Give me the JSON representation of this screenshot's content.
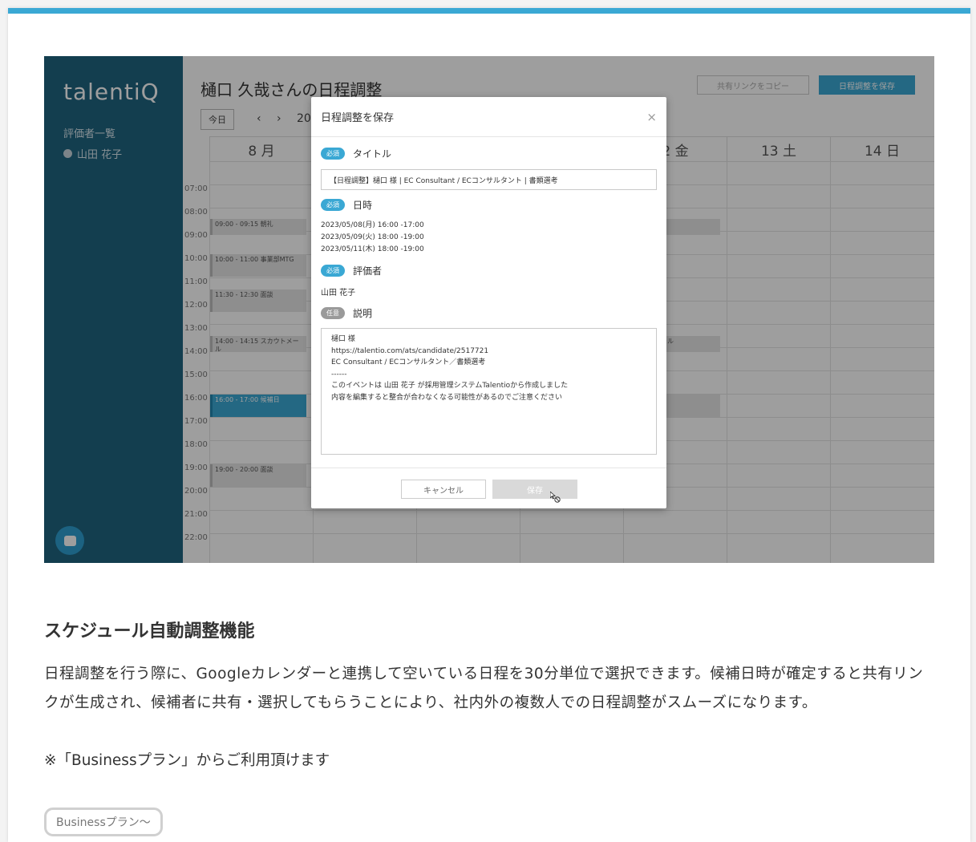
{
  "screenshot": {
    "logo": "talentiQ",
    "sidebar": {
      "evaluators_link": "評価者一覧",
      "user": "山田 花子"
    },
    "calendar": {
      "title": "樋口 久哉さんの日程調整",
      "share_link_button": "共有リンクをコピー",
      "save_button": "日程調整を保存",
      "today_button": "今日",
      "prev": "‹",
      "next": "›",
      "year_partial": "20",
      "day_headers": [
        "8 月",
        "",
        "",
        "2 金",
        "13 土",
        "14 日"
      ],
      "hours": [
        "07:00",
        "08:00",
        "09:00",
        "10:00",
        "11:00",
        "12:00",
        "13:00",
        "14:00",
        "15:00",
        "16:00",
        "17:00",
        "18:00",
        "19:00",
        "20:00",
        "21:00",
        "22:00"
      ],
      "events": [
        {
          "text": "09:00 - 09:15  朝礼"
        },
        {
          "text": "10:00 - 11:00 事業部MTG"
        },
        {
          "text": "11:30 - 12:30 面談"
        },
        {
          "text": "14:00 - 14:15  スカウトメール"
        },
        {
          "text": "16:00 - 17:00 候補日"
        },
        {
          "text": "19:00 - 20:00 面談"
        },
        {
          "text": "朝礼"
        },
        {
          "text": "スカウトメール"
        },
        {
          "text": ""
        }
      ]
    },
    "modal": {
      "title": "日程調整を保存",
      "close": "×",
      "required_badge": "必須",
      "optional_badge": "任意",
      "field_title_label": "タイトル",
      "field_title_value": "【日程調整】樋口 様 | EC Consultant / ECコンサルタント | 書類選考",
      "field_date_label": "日時",
      "dates": [
        "2023/05/08(月) 16:00 -17:00",
        "2023/05/09(火) 18:00 -19:00",
        "2023/05/11(木) 18:00 -19:00"
      ],
      "field_evaluator_label": "評価者",
      "evaluator": "山田 花子",
      "field_desc_label": "説明",
      "description_lines": [
        "樋口 様",
        "https://talentio.com/ats/candidate/2517721",
        "EC Consultant / ECコンサルタント／書類選考",
        "------",
        " このイベントは 山田 花子 が採用管理システムTalentioから作成しました",
        "内容を編集すると整合が合わなくなる可能性があるのでご注意ください"
      ],
      "cancel_button": "キャンセル",
      "save_button": "保存"
    }
  },
  "feature": {
    "title": "スケジュール自動調整機能",
    "body": "日程調整を行う際に、Googleカレンダーと連携して空いている日程を30分単位で選択できます。候補日時が確定すると共有リンクが生成され、候補者に共有・選択してもらうことにより、社内外の複数人での日程調整がスムーズになります。",
    "note": "※「Businessプラン」からご利用頂けます",
    "plan_tag": "Businessプラン〜"
  },
  "colors": {
    "accent": "#3aa8d4",
    "sidebar": "#1f6480"
  }
}
